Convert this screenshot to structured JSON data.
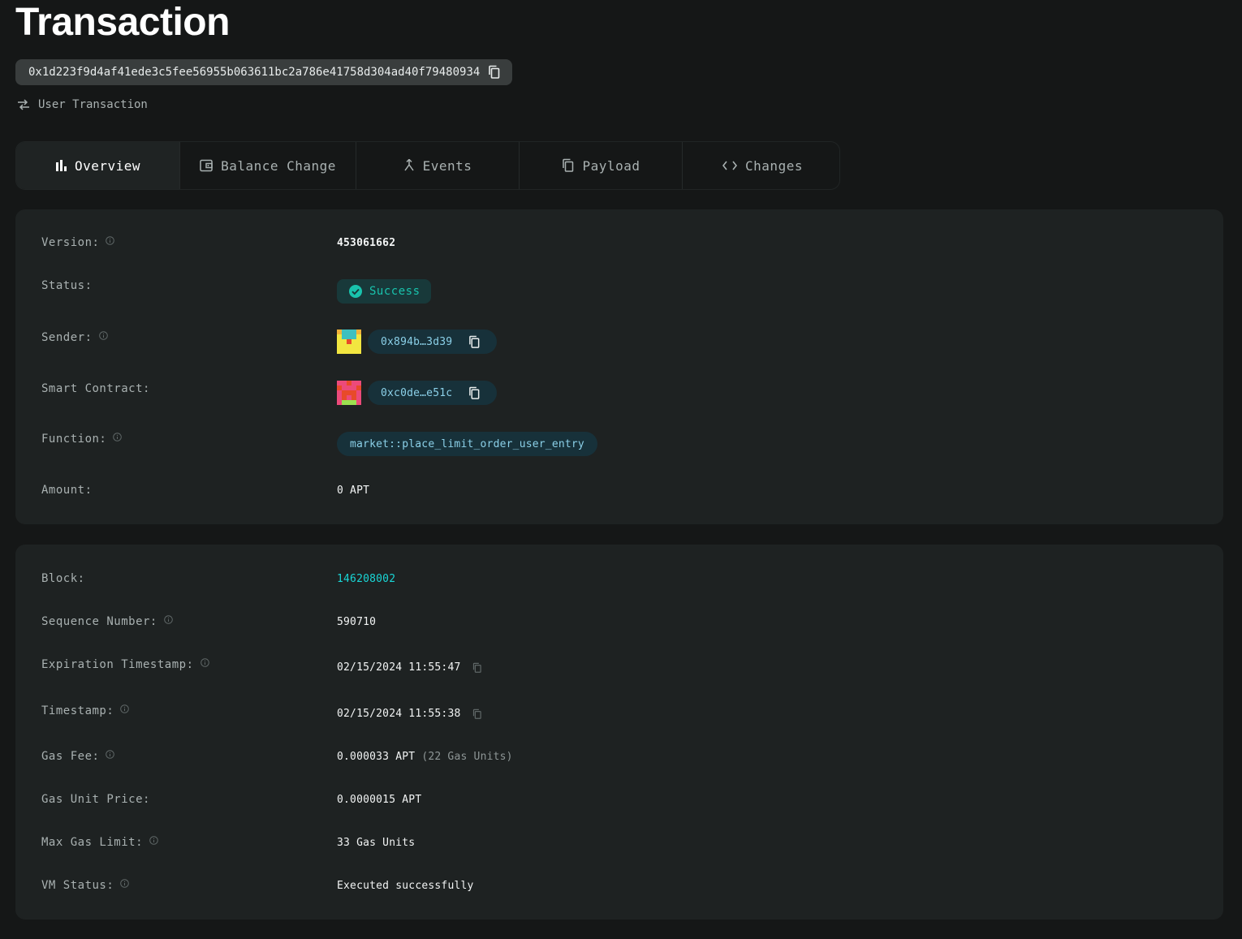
{
  "page": {
    "title": "Transaction",
    "hash": "0x1d223f9d4af41ede3c5fee56955b063611bc2a786e41758d304ad40f79480934",
    "tx_type": "User Transaction"
  },
  "tabs": [
    {
      "label": "Overview",
      "icon": "bar-chart-icon",
      "active": true
    },
    {
      "label": "Balance Change",
      "icon": "wallet-icon",
      "active": false
    },
    {
      "label": "Events",
      "icon": "merge-icon",
      "active": false
    },
    {
      "label": "Payload",
      "icon": "copy-icon",
      "active": false
    },
    {
      "label": "Changes",
      "icon": "code-icon",
      "active": false
    }
  ],
  "overview": {
    "version_label": "Version:",
    "version": "453061662",
    "status_label": "Status:",
    "status": "Success",
    "sender_label": "Sender:",
    "sender": "0x894b…3d39",
    "contract_label": "Smart Contract:",
    "contract": "0xc0de…e51c",
    "function_label": "Function:",
    "function": "market::place_limit_order_user_entry",
    "amount_label": "Amount:",
    "amount": "0 APT"
  },
  "details": {
    "block_label": "Block:",
    "block": "146208002",
    "sequence_label": "Sequence Number:",
    "sequence": "590710",
    "expiration_label": "Expiration Timestamp:",
    "expiration": "02/15/2024 11:55:47",
    "timestamp_label": "Timestamp:",
    "timestamp": "02/15/2024 11:55:38",
    "gas_fee_label": "Gas Fee:",
    "gas_fee": "0.000033 APT",
    "gas_fee_units": "(22 Gas Units)",
    "gas_price_label": "Gas Unit Price:",
    "gas_price": "0.0000015 APT",
    "max_gas_label": "Max Gas Limit:",
    "max_gas": "33 Gas Units",
    "vm_status_label": "VM Status:",
    "vm_status": "Executed successfully"
  },
  "colors": {
    "background": "#151717",
    "card": "#1e2222",
    "accent_teal": "#19d6d6",
    "success": "#19c3ad",
    "pill_bg": "#17313a"
  }
}
